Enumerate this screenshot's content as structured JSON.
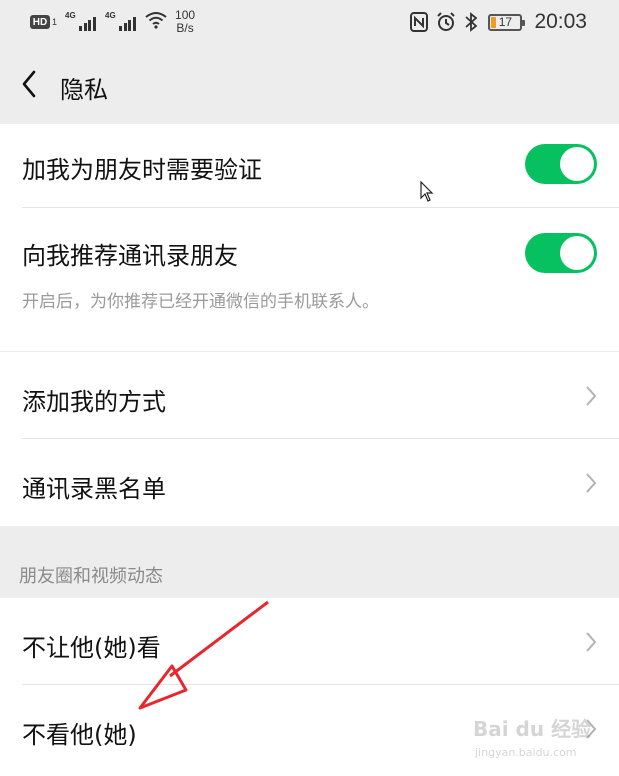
{
  "status_bar": {
    "hd_badge": "HD",
    "hd_sub": "1",
    "signal_1": "4G",
    "signal_2": "4G",
    "net_speed_value": "100",
    "net_speed_unit": "B/s",
    "battery_level": "17",
    "time": "20:03"
  },
  "nav": {
    "title": "隐私"
  },
  "settings": {
    "verify_friend_label": "加我为朋友时需要验证",
    "verify_friend_on": true,
    "recommend_contacts_label": "向我推荐通讯录朋友",
    "recommend_contacts_on": true,
    "recommend_contacts_hint": "开启后，为你推荐已经开通微信的手机联系人。",
    "add_methods_label": "添加我的方式",
    "blacklist_label": "通讯录黑名单"
  },
  "moments_section": {
    "header": "朋友圈和视频动态",
    "hide_my_posts_label": "不让他(她)看",
    "hide_their_posts_label": "不看他(她)"
  },
  "colors": {
    "toggle_on": "#07c160",
    "background": "#ededed",
    "annotation_arrow": "#e8262e"
  },
  "watermark": {
    "text_main": "Bai du 经验",
    "text_sub": "jingyan.baidu.com"
  }
}
